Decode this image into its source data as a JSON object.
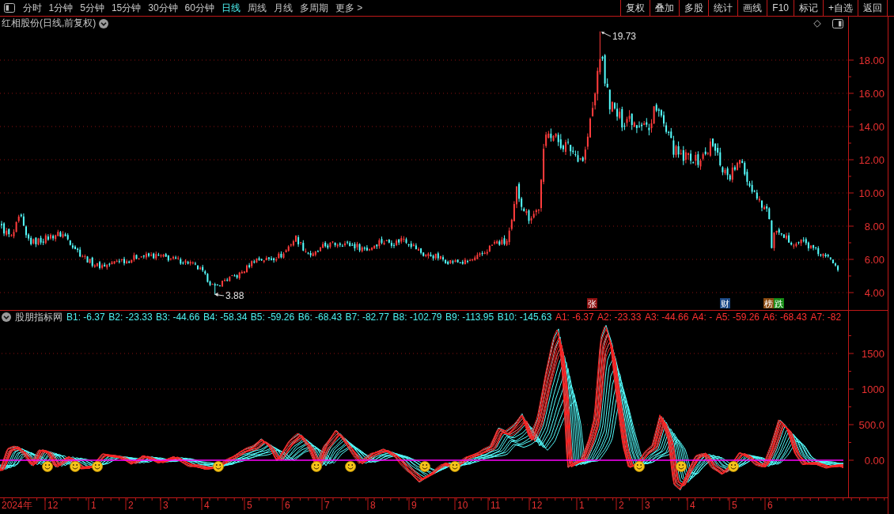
{
  "toolbar": {
    "periods": [
      {
        "label": "分时",
        "selected": false
      },
      {
        "label": "1分钟",
        "selected": false
      },
      {
        "label": "5分钟",
        "selected": false
      },
      {
        "label": "15分钟",
        "selected": false
      },
      {
        "label": "30分钟",
        "selected": false
      },
      {
        "label": "60分钟",
        "selected": false
      },
      {
        "label": "日线",
        "selected": true
      },
      {
        "label": "周线",
        "selected": false
      },
      {
        "label": "月线",
        "selected": false
      },
      {
        "label": "多周期",
        "selected": false
      },
      {
        "label": "更多 >",
        "selected": false
      }
    ],
    "actions": [
      "复权",
      "叠加",
      "多股",
      "统计",
      "画线",
      "F10",
      "标记",
      "+自选",
      "返回"
    ]
  },
  "price_panel": {
    "title": "红相股份(日线,前复权)",
    "axis_labels": [
      "18.00",
      "16.00",
      "14.00",
      "12.00",
      "10.00",
      "8.00",
      "6.00",
      "4.00"
    ],
    "high_label": "19.73",
    "low_label": "3.88",
    "events": [
      {
        "label": "张",
        "color": "#8c1010"
      },
      {
        "label": "财",
        "color": "#1c4a86"
      },
      {
        "label": "榜",
        "color": "#8a4a10"
      },
      {
        "label": "跌",
        "color": "#148a14"
      }
    ]
  },
  "indicator_panel": {
    "title": "股朋指标网",
    "values": [
      {
        "label": "B1: -6.37",
        "color": "#4ef0f0"
      },
      {
        "label": "B2: -23.33",
        "color": "#4ef0f0"
      },
      {
        "label": "B3: -44.66",
        "color": "#4ef0f0"
      },
      {
        "label": "B4: -58.34",
        "color": "#4ef0f0"
      },
      {
        "label": "B5: -59.26",
        "color": "#4ef0f0"
      },
      {
        "label": "B6: -68.43",
        "color": "#4ef0f0"
      },
      {
        "label": "B7: -82.77",
        "color": "#4ef0f0"
      },
      {
        "label": "B8: -102.79",
        "color": "#4ef0f0"
      },
      {
        "label": "B9: -113.95",
        "color": "#4ef0f0"
      },
      {
        "label": "B10: -145.63",
        "color": "#4ef0f0"
      },
      {
        "label": "A1: -6.37",
        "color": "#ff3030"
      },
      {
        "label": "A2: -23.33",
        "color": "#ff3030"
      },
      {
        "label": "A3: -44.66",
        "color": "#ff3030"
      },
      {
        "label": "A4: -",
        "color": "#ff3030"
      },
      {
        "label": "A5: -59.26",
        "color": "#ff3030"
      },
      {
        "label": "A6: -68.43",
        "color": "#ff3030"
      },
      {
        "label": "A7: -82",
        "color": "#ff3030"
      }
    ],
    "axis_labels": [
      "1500",
      "1000",
      "500.0",
      "0.00"
    ]
  },
  "time_axis": {
    "labels": [
      "2024年",
      "12",
      "1",
      "2",
      "3",
      "4",
      "5",
      "6",
      "7",
      "8",
      "9",
      "10",
      "11",
      "12",
      "1",
      "2",
      "3",
      "4",
      "5",
      "6"
    ]
  }
}
